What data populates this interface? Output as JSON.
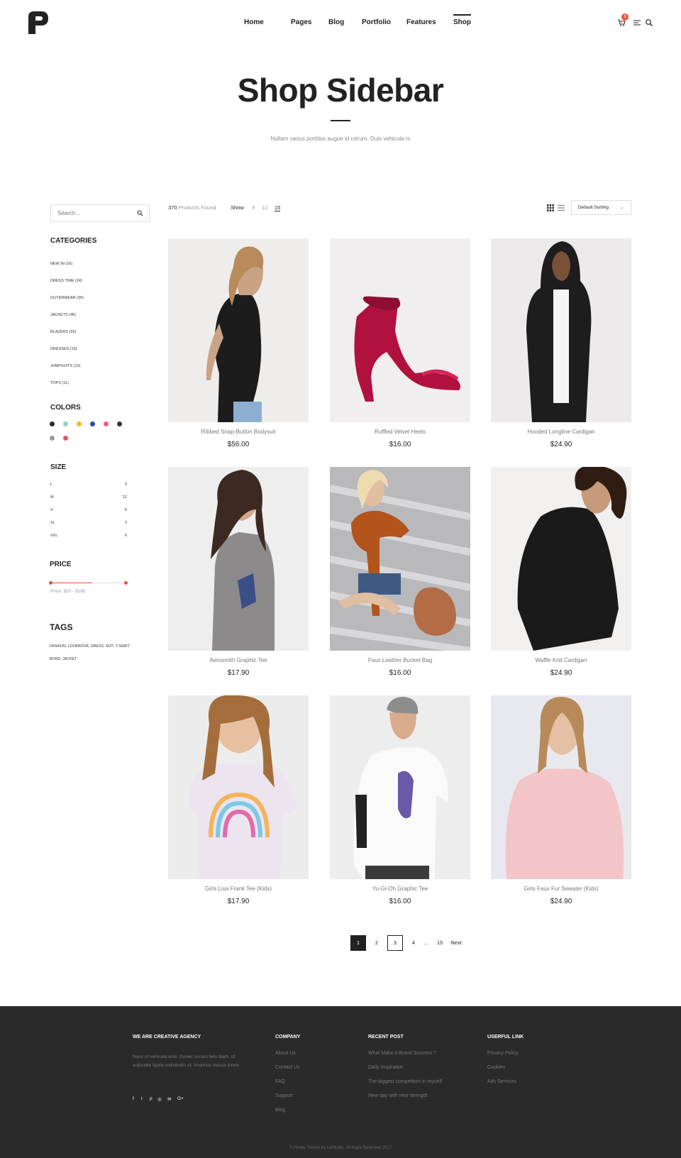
{
  "nav": {
    "items": [
      "Home",
      "Pages",
      "Blog",
      "Portfolio",
      "Features",
      "Shop"
    ],
    "active": "Shop",
    "cart_count": "1"
  },
  "hero": {
    "title": "Shop Sidebar",
    "subtitle": "Nullam varius porttitor augue id rutrum. Duis vehicula m"
  },
  "sidebar": {
    "search_placeholder": "Search...",
    "categories_title": "CATEGORIES",
    "categories": [
      "NEW IN (16)",
      "DRESS TIME (24)",
      "OUTERWEAR (36)",
      "JACKETS (45)",
      "BLAZERS (26)",
      "DRESSES (15)",
      "JUMPSUITS (12)",
      "TOPS (11)"
    ],
    "colors_title": "COLORS",
    "colors": [
      "#2a2a2a",
      "#8fd3c2",
      "#f4b533",
      "#2d4a9e",
      "#ef5d7c",
      "#333333",
      "#9a9a9a",
      "#e85563"
    ],
    "size_title": "SIZE",
    "sizes": [
      {
        "label": "L",
        "count": "5"
      },
      {
        "label": "M",
        "count": "12"
      },
      {
        "label": "S",
        "count": "6"
      },
      {
        "label": "XL",
        "count": "2"
      },
      {
        "label": "XXL",
        "count": "6"
      }
    ],
    "price_title": "PRICE",
    "price_text": "Price: $20 - $185",
    "price_range": [
      0,
      0.55
    ],
    "tags_title": "TAGS",
    "tags_line1": "FASHION, LOOKBOOK, DRESS, SUIT, T-SHIRT",
    "tags_line2": "BOHO, JACKET"
  },
  "toolbar": {
    "found_count": "370",
    "found_label": "Products Found",
    "show_label": "Show",
    "per_page": [
      "9",
      "12",
      "15"
    ],
    "per_page_active": "15",
    "sort_label": "Default Sorting"
  },
  "products": [
    {
      "name": "Ribbed Snap-Button Bodysuit",
      "price": "$56.00"
    },
    {
      "name": "Ruffled Velvet Heels",
      "price": "$16.00"
    },
    {
      "name": "Hooded Longline Cardigan",
      "price": "$24.90"
    },
    {
      "name": "Aerosmith Graphic Tee",
      "price": "$17.90"
    },
    {
      "name": "Faux Leather Bucket Bag",
      "price": "$16.00"
    },
    {
      "name": "Waffle Knit Cardigan",
      "price": "$24.90"
    },
    {
      "name": "Girls Lisa Frank Tee (Kids)",
      "price": "$17.90"
    },
    {
      "name": "Yu-Gi-Oh Graphic Tee",
      "price": "$16.00"
    },
    {
      "name": "Girls Faux Fur Sweater (Kids)",
      "price": "$24.90"
    }
  ],
  "pagination": {
    "pages": [
      "1",
      "2",
      "3",
      "4",
      "...",
      "15"
    ],
    "current": "1",
    "next": "Next"
  },
  "footer": {
    "about_title": "WE ARE CREATIVE AGENCY",
    "about_text": "Nunc ut vehicula ante. Donec cursus felis diam, ut vulputate ligula sollicitudin at. Vivamus massa lorem",
    "social": [
      "f",
      "t",
      "p",
      "◎",
      "✉",
      "G+"
    ],
    "company_title": "COMPANY",
    "company_links": [
      "About Us",
      "Contact Us",
      "FAQ",
      "Support",
      "Blog"
    ],
    "recent_title": "RECENT POST",
    "recent_links": [
      "What Make A Brand Success ?",
      "Daily Inspiration",
      "The biggest competition in myself",
      "New day with new strength"
    ],
    "useful_title": "USERFUL LINK",
    "useful_links": [
      "Privacy Policy",
      "Cookies",
      "Ads Services"
    ],
    "copyright": "© Pinole Theme by LaStudio. All Right Reserved 2017"
  }
}
